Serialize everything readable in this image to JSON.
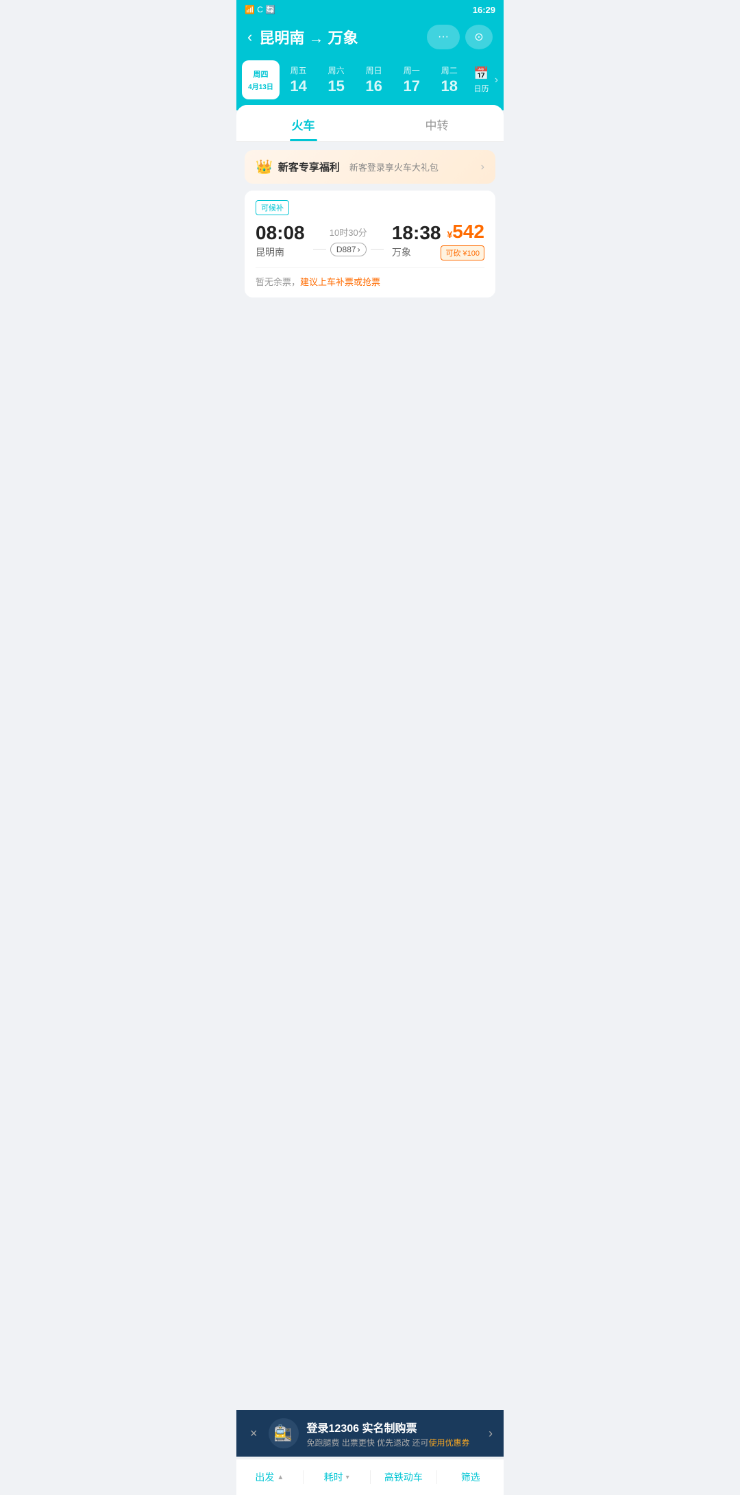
{
  "statusBar": {
    "time": "16:29",
    "icons": "4G ▮▮▮"
  },
  "header": {
    "backLabel": "‹",
    "origin": "昆明南",
    "arrow": "→",
    "destination": "万象",
    "moreLabel": "···",
    "cameraLabel": "⊙"
  },
  "datePicker": {
    "days": [
      {
        "id": "thu",
        "weekday": "周四",
        "day": "4月13日",
        "active": true,
        "full": true
      },
      {
        "id": "fri",
        "weekday": "周五",
        "day": "14",
        "active": false
      },
      {
        "id": "sat",
        "weekday": "周六",
        "day": "15",
        "active": false
      },
      {
        "id": "sun",
        "weekday": "周日",
        "day": "16",
        "active": false
      },
      {
        "id": "mon",
        "weekday": "周一",
        "day": "17",
        "active": false
      },
      {
        "id": "tue",
        "weekday": "周二",
        "day": "18",
        "active": false
      }
    ],
    "calendarLabel": "日历",
    "arrowRight": "›"
  },
  "tabs": [
    {
      "id": "train",
      "label": "火车",
      "active": true
    },
    {
      "id": "transfer",
      "label": "中转",
      "active": false
    }
  ],
  "promoBanner": {
    "icon": "👑",
    "title": "新客专享福利",
    "subtitle": "新客登录享火车大礼包",
    "arrow": "›"
  },
  "trainResult": {
    "tag": "可候补",
    "departTime": "08:08",
    "origin": "昆明南",
    "duration": "10时30分",
    "trainNumber": "D887",
    "arrowRight": "›",
    "arriveTime": "18:38",
    "destination": "万象",
    "priceSymbol": "¥",
    "price": "542",
    "discount": "可砍 ¥100",
    "noTicketText": "暂无余票，",
    "noTicketLink": "建议上车补票或抢票"
  },
  "ctaBanner": {
    "closeLabel": "×",
    "icon": "⊙",
    "title": "登录12306 实名制购票",
    "subtitle": "免跑腿费 出票更快 优先退改 还可",
    "highlightText": "使用优惠券",
    "arrow": "›"
  },
  "bottomNav": [
    {
      "id": "depart",
      "label": "出发",
      "arrow": "▲"
    },
    {
      "id": "duration",
      "label": "耗时",
      "arrow": "▾"
    },
    {
      "id": "highspeed",
      "label": "高铁动车"
    },
    {
      "id": "filter",
      "label": "筛选"
    }
  ]
}
